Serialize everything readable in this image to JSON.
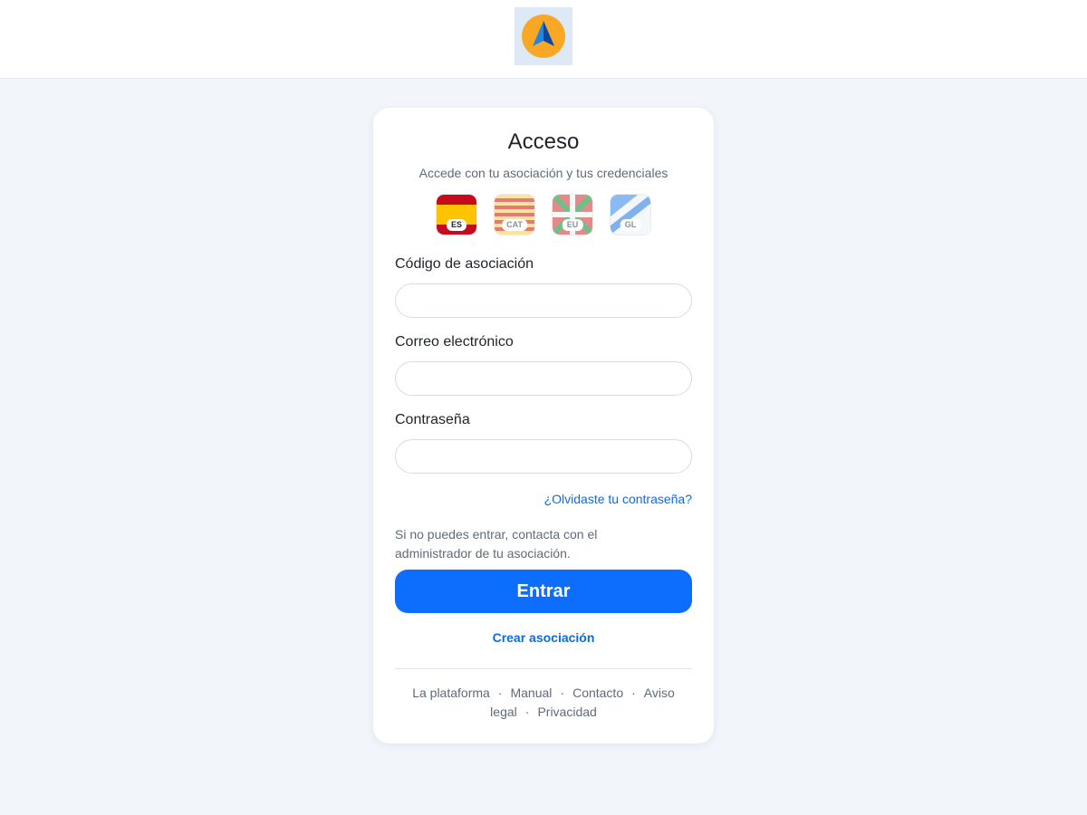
{
  "header": {
    "logo_icon": "navigation-arrow-icon"
  },
  "login": {
    "title": "Acceso",
    "subtitle": "Accede con tu asociación y tus credenciales",
    "languages": [
      {
        "code": "ES",
        "icon": "spain-flag-icon"
      },
      {
        "code": "CAT",
        "icon": "catalonia-flag-icon"
      },
      {
        "code": "EU",
        "icon": "basque-flag-icon"
      },
      {
        "code": "GL",
        "icon": "galicia-flag-icon"
      }
    ],
    "fields": {
      "association_code": {
        "label": "Código de asociación",
        "value": "",
        "placeholder": ""
      },
      "email": {
        "label": "Correo electrónico",
        "value": "",
        "placeholder": ""
      },
      "password": {
        "label": "Contraseña",
        "value": "",
        "placeholder": ""
      }
    },
    "forgot_link": "¿Olvidaste tu contraseña?",
    "help_text": "Si no puedes entrar, contacta con el administrador de tu asociación.",
    "submit_label": "Entrar",
    "create_link": "Crear asociación"
  },
  "footer": {
    "links": [
      "La plataforma",
      "Manual",
      "Contacto",
      "Aviso legal",
      "Privacidad"
    ],
    "separator": "·"
  },
  "colors": {
    "accent": "#0d6efd",
    "link": "#0b6ce0",
    "background": "#f2f6fb",
    "logo_circle": "#f9a825",
    "logo_arrow": "#1565c0"
  }
}
